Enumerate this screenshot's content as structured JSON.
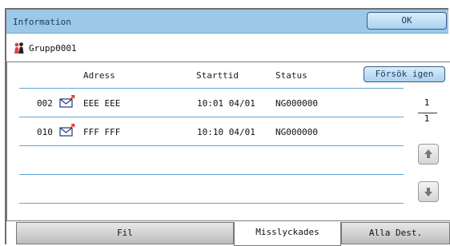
{
  "header": {
    "title": "Information",
    "ok_label": "OK"
  },
  "group": {
    "name": "Grupp0001",
    "icon": "group-people-icon"
  },
  "table": {
    "columns": [
      "Adress",
      "Starttid",
      "Status"
    ],
    "retry_label": "Försök igen",
    "rows": [
      {
        "number": "002",
        "icon": "mail-sent-icon",
        "name": "EEE EEE",
        "time": "10:01 04/01",
        "status": "NG000000"
      },
      {
        "number": "010",
        "icon": "mail-sent-icon",
        "name": "FFF FFF",
        "time": "10:10 04/01",
        "status": "NG000000"
      }
    ]
  },
  "pager": {
    "current": "1",
    "total": "1",
    "up_icon": "arrow-up-icon",
    "down_icon": "arrow-down-icon"
  },
  "tabs": [
    {
      "label": "Fil"
    },
    {
      "label": "Misslyckades"
    },
    {
      "label": "Alla Dest."
    }
  ],
  "colors": {
    "accent": "#9cc9e8",
    "separator": "#5ea6d4",
    "button_border": "#365b8a"
  }
}
